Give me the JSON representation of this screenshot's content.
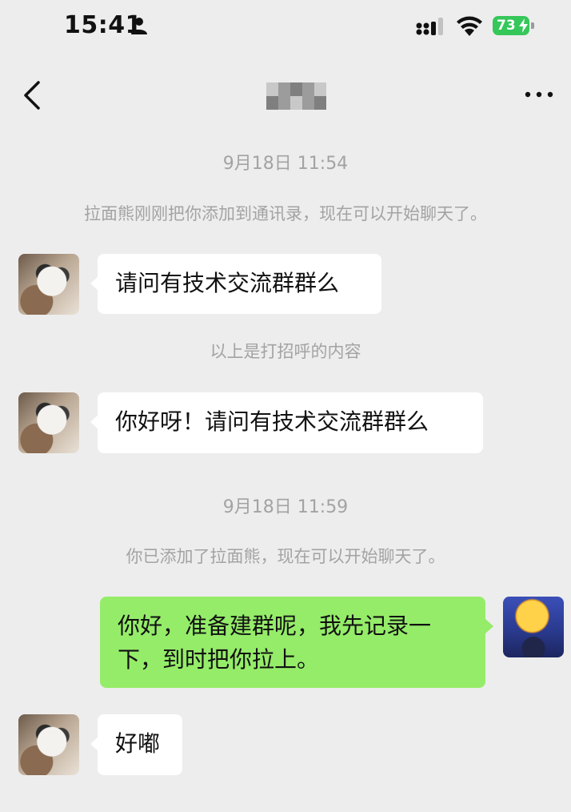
{
  "status_bar": {
    "time": "15:41",
    "battery_level": "73",
    "icons": [
      "person-icon",
      "signal-icon",
      "wifi-icon",
      "battery-icon",
      "charging-bolt-icon"
    ]
  },
  "nav": {
    "back_icon": "chevron-left-icon",
    "more_icon": "ellipsis-icon"
  },
  "messages": {
    "ts1": "9月18日 11:54",
    "sys1": "拉面熊刚刚把你添加到通讯录，现在可以开始聊天了。",
    "msg1": "请问有技术交流群群么",
    "sys2": "以上是打招呼的内容",
    "msg2": "你好呀！请问有技术交流群群么",
    "ts2": "9月18日 11:59",
    "sys3": "你已添加了拉面熊，现在可以开始聊天了。",
    "msg3_line1": "你好，准备建群呢，我先记录一",
    "msg3_line2": "下，到时把你拉上。",
    "msg4": "好嘟"
  },
  "colors": {
    "background": "#ededed",
    "incoming_bubble": "#ffffff",
    "outgoing_bubble": "#95ec69",
    "system_text": "#a3a3a3",
    "battery": "#35c759"
  }
}
